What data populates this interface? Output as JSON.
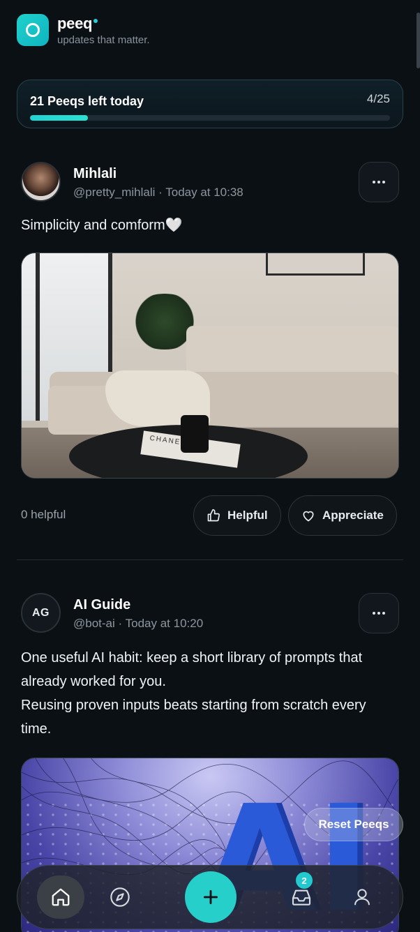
{
  "app": {
    "name": "peeq",
    "tagline": "updates that matter."
  },
  "quota": {
    "label": "21 Peeqs left today",
    "count": "4/25",
    "progress_fraction": 0.16
  },
  "posts": [
    {
      "author": "Mihlali",
      "handle": "@pretty_mihlali",
      "time": "Today at 10:38",
      "separator": "·",
      "text": "Simplicity and comform🤍",
      "helpful_count": "0 helpful",
      "helpful_label": "Helpful",
      "appreciate_label": "Appreciate",
      "book_text": "CHANEL"
    },
    {
      "author": "AI Guide",
      "initials": "AG",
      "handle": "@bot-ai",
      "time": "Today at 10:20",
      "separator": "·",
      "text_lines": [
        "One useful AI habit: keep a short library of prompts that already worked for you.",
        "Reusing proven inputs beats starting from scratch every time."
      ],
      "image_text": "AI"
    }
  ],
  "floating": {
    "reset_label": "Reset Peeqs"
  },
  "nav": {
    "items": [
      "home-icon",
      "compass-icon",
      "plus-icon",
      "inbox-icon",
      "user-icon"
    ],
    "inbox_badge": "2"
  },
  "colors": {
    "accent": "#26cfc9",
    "background": "#0b1015"
  }
}
